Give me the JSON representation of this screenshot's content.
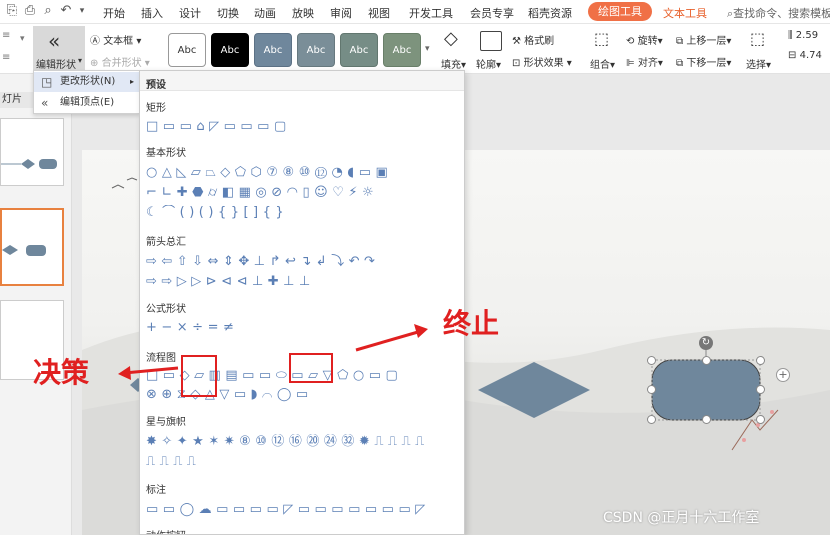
{
  "titlebar": {
    "tabs": [
      "开始",
      "插入",
      "设计",
      "切换",
      "动画",
      "放映",
      "审阅",
      "视图",
      "开发工具",
      "会员专享",
      "稻壳资源"
    ],
    "active_tab": "绘图工具",
    "text_tools_tab": "文本工具",
    "search_placeholder": "查找命令、搜索模板"
  },
  "ribbon": {
    "edit_shape": "编辑形状",
    "textbox": "文本框",
    "merge_shape": "合并形状",
    "style_samples": [
      "Abc",
      "Abc",
      "Abc",
      "Abc",
      "Abc",
      "Abc"
    ],
    "fill": "填充",
    "outline": "轮廓",
    "format_brush": "格式刷",
    "shape_effect": "形状效果",
    "group": "组合",
    "rotate": "旋转",
    "align": "对齐",
    "bring_forward": "上移一层",
    "send_backward": "下移一层",
    "select": "选择",
    "height": "2.59",
    "width": "4.74"
  },
  "left_panel": {
    "label": "灯片"
  },
  "dropdown": {
    "change_shape": "更改形状(N)",
    "edit_points": "编辑顶点(E)"
  },
  "shapes_panel": {
    "header": "预设",
    "sections": [
      {
        "title": "矩形",
        "rows": [
          "□▭▭⌂◸▭▭▭▢"
        ]
      },
      {
        "title": "基本形状",
        "rows": [
          "○△◺▱⏢◇⬠⬡⑦⑧⑩⑫◔◖▭▣",
          "⌐∟✚⬣⌭◧▦◎⊘◠▯☺♡⚡☼",
          "☾⌒()(){}[]{}"
        ]
      },
      {
        "title": "箭头总汇",
        "rows": [
          "⇨⇦⇧⇩⇔⇕✥⊥↱↩↴↲⤵↶↷",
          "⇨⇨▷▷⊳⊲⊲⊥✚⊥⊥"
        ]
      },
      {
        "title": "公式形状",
        "rows": [
          "+−×÷=≠"
        ]
      },
      {
        "title": "流程图",
        "rows": [
          "□▭◇▱▥▤▭▭⬭▭▱▽⬠○▭▢",
          "⊗⊕⧖◇△▽▭◗⌒◯▭"
        ]
      },
      {
        "title": "星与旗帜",
        "rows": [
          "✸✧✦★✶✷⑧⑩⑫⑯⑳㉔㉜✹⎍⎍⎍⎍",
          "⎍⎍⎍⎍"
        ]
      },
      {
        "title": "标注",
        "rows": [
          "▭▭◯☁▭▭▭▭◸▭▭▭▭▭▭▭◸"
        ]
      },
      {
        "title": "动作按钮",
        "rows": []
      }
    ]
  },
  "annotations": {
    "decision": "决策",
    "terminator": "终止"
  },
  "watermark": "CSDN @正月十六工作室"
}
